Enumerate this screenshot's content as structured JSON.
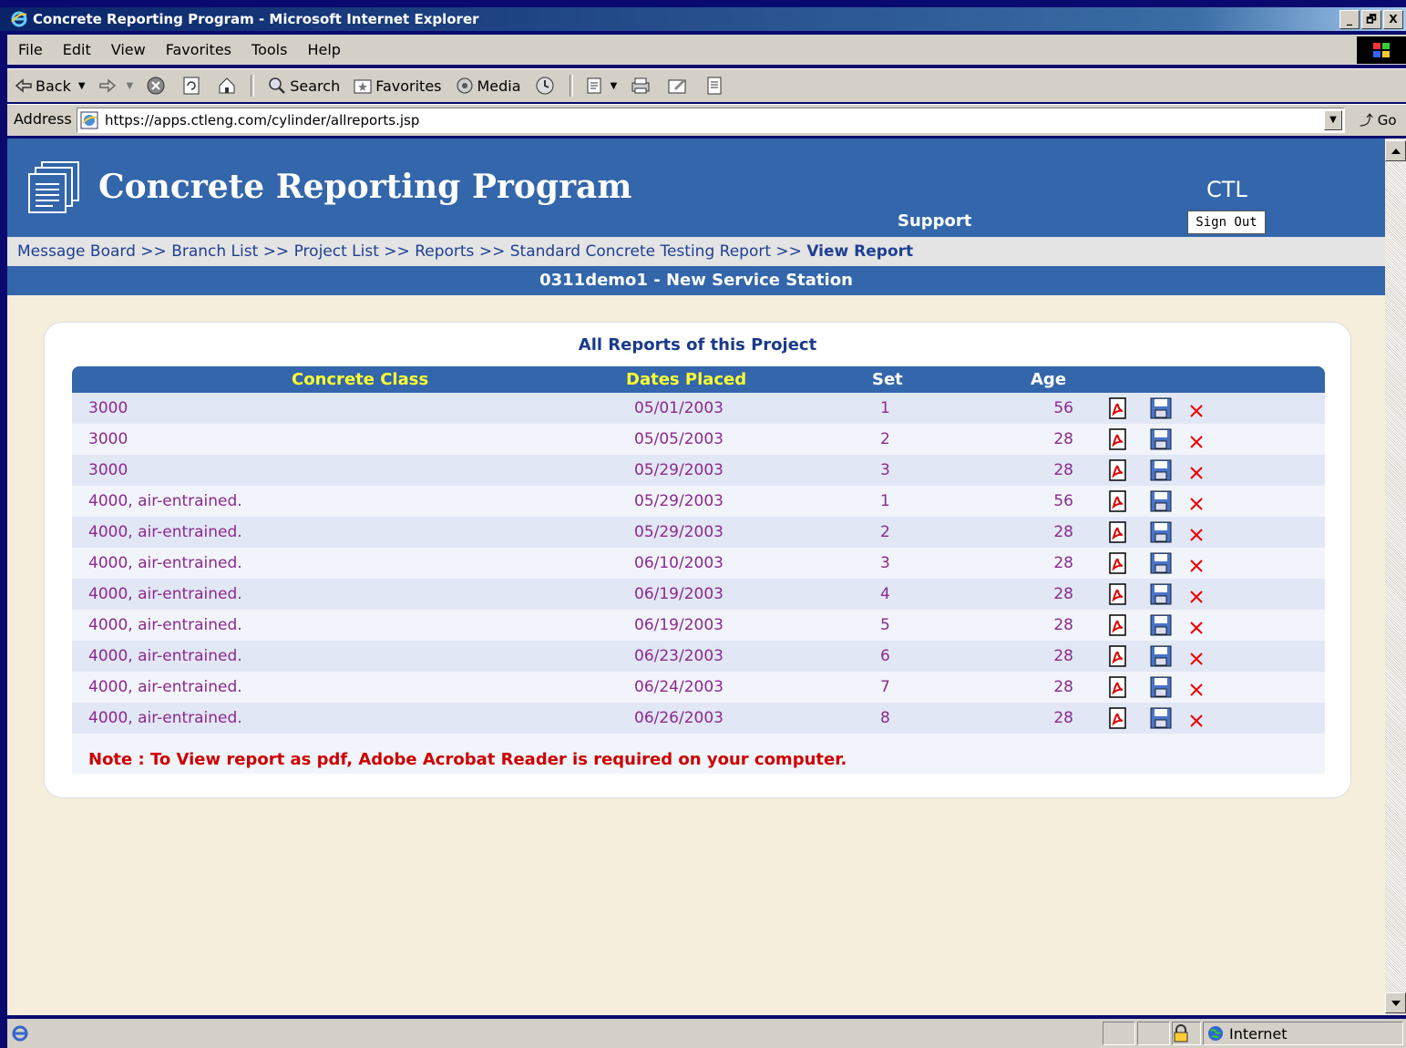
{
  "window": {
    "title": "Concrete Reporting Program - Microsoft Internet Explorer",
    "minimize": "_",
    "restore": "🗗",
    "close": "X"
  },
  "menu": {
    "items": [
      {
        "label": "File"
      },
      {
        "label": "Edit"
      },
      {
        "label": "View"
      },
      {
        "label": "Favorites"
      },
      {
        "label": "Tools"
      },
      {
        "label": "Help"
      }
    ]
  },
  "toolbar": {
    "back": "Back",
    "search": "Search",
    "favorites": "Favorites",
    "media": "Media"
  },
  "address": {
    "label": "Address",
    "url": "https://apps.ctleng.com/cylinder/allreports.jsp",
    "go": "Go"
  },
  "app": {
    "title": "Concrete Reporting Program",
    "support": "Support",
    "company": "CTL",
    "signout": "Sign Out"
  },
  "breadcrumb": {
    "items": [
      "Message Board",
      "Branch List",
      "Project List",
      "Reports",
      "Standard Concrete Testing Report"
    ],
    "separator": ">>",
    "current": "View Report"
  },
  "project": {
    "name": "0311demo1 - New Service Station"
  },
  "reports": {
    "title": "All Reports of this Project",
    "columns": {
      "concrete_class": "Concrete Class",
      "dates_placed": "Dates Placed",
      "set": "Set",
      "age": "Age"
    },
    "rows": [
      {
        "concrete_class": "3000",
        "date": "05/01/2003",
        "set": "1",
        "age": "56"
      },
      {
        "concrete_class": "3000",
        "date": "05/05/2003",
        "set": "2",
        "age": "28"
      },
      {
        "concrete_class": "3000",
        "date": "05/29/2003",
        "set": "3",
        "age": "28"
      },
      {
        "concrete_class": "4000, air-entrained.",
        "date": "05/29/2003",
        "set": "1",
        "age": "56"
      },
      {
        "concrete_class": "4000, air-entrained.",
        "date": "05/29/2003",
        "set": "2",
        "age": "28"
      },
      {
        "concrete_class": "4000, air-entrained.",
        "date": "06/10/2003",
        "set": "3",
        "age": "28"
      },
      {
        "concrete_class": "4000, air-entrained.",
        "date": "06/19/2003",
        "set": "4",
        "age": "28"
      },
      {
        "concrete_class": "4000, air-entrained.",
        "date": "06/19/2003",
        "set": "5",
        "age": "28"
      },
      {
        "concrete_class": "4000, air-entrained.",
        "date": "06/23/2003",
        "set": "6",
        "age": "28"
      },
      {
        "concrete_class": "4000, air-entrained.",
        "date": "06/24/2003",
        "set": "7",
        "age": "28"
      },
      {
        "concrete_class": "4000, air-entrained.",
        "date": "06/26/2003",
        "set": "8",
        "age": "28"
      }
    ],
    "note": "Note : To View report as pdf, Adobe Acrobat Reader is required on your computer."
  },
  "status": {
    "zone": "Internet"
  },
  "colors": {
    "header_blue": "#3366aa",
    "content_bg": "#f5eedb",
    "row_text": "#8b2990",
    "header_highlight": "#ffff33",
    "note_red": "#cc0000"
  }
}
